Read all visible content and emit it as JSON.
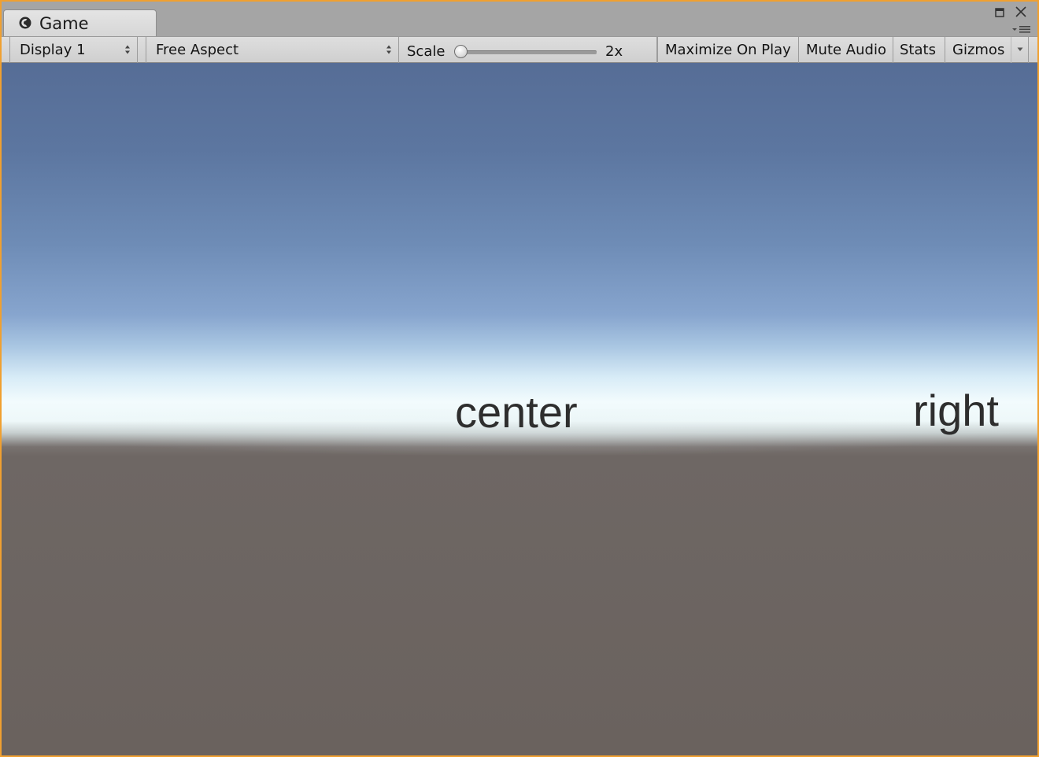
{
  "window": {
    "tab_title": "Game",
    "accent_border": "#f0a030"
  },
  "toolbar": {
    "display": {
      "label": "Display 1"
    },
    "aspect": {
      "label": "Free Aspect"
    },
    "scale": {
      "label": "Scale",
      "value_label": "2x",
      "slider_value": 0.0
    },
    "maximize_on_play": "Maximize On Play",
    "mute_audio": "Mute Audio",
    "stats": "Stats",
    "gizmos": "Gizmos"
  },
  "icons": {
    "tab_icon": "unity-game-icon",
    "maximize": "maximize-icon",
    "close": "close-icon",
    "tab_menu": "tab-menu-icon",
    "dropdown": "updown-arrows-icon",
    "gizmos_dropdown": "chevron-down-icon"
  },
  "viewport": {
    "sky_top_color": "#566d96",
    "horizon_color": "#f2fbfd",
    "ground_color": "#6a625e",
    "labels": {
      "center": "center",
      "right": "right"
    }
  }
}
